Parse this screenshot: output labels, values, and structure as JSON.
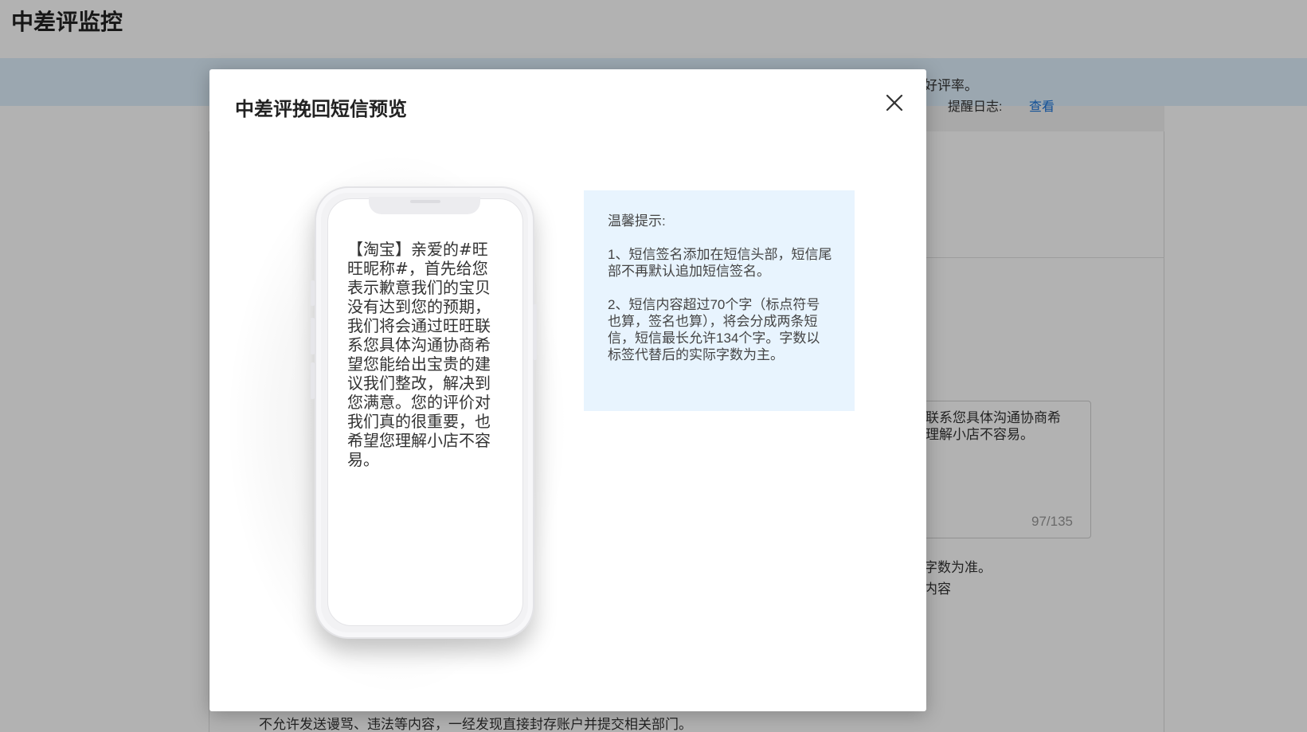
{
  "page": {
    "title": "中差评监控"
  },
  "background": {
    "notice_tail": "好评率。",
    "remind_label": "提醒日志:",
    "remind_link": "查看",
    "textarea_fragment": "联系您具体沟通协商希\n理解小店不容易。",
    "counter": "97/135",
    "note_1_fragment": "字数为准。",
    "note_2_fragment": "内容",
    "warning": "不允许发送谩骂、违法等内容，一经发现直接封存账户并提交相关部门。"
  },
  "modal": {
    "title": "中差评挽回短信预览",
    "close_icon": "close-icon",
    "sms_preview": "【淘宝】亲爱的#旺旺昵称#，首先给您表示歉意我们的宝贝没有达到您的预期，我们将会通过旺旺联系您具体沟通协商希望您能给出宝贵的建议我们整改，解决到您满意。您的评价对我们真的很重要，也希望您理解小店不容易。",
    "tips": {
      "heading": "温馨提示:",
      "tip_1": "1、短信签名添加在短信头部，短信尾部不再默认追加短信签名。",
      "tip_2": "2、短信内容超过70个字（标点符号也算，签名也算），将会分成两条短信，短信最长允许134个字。字数以标签代替后的实际字数为主。"
    }
  },
  "colors": {
    "accent_link": "#1a73d9",
    "tips_background": "#e8f4fe",
    "notice_background": "#dff0fc"
  }
}
